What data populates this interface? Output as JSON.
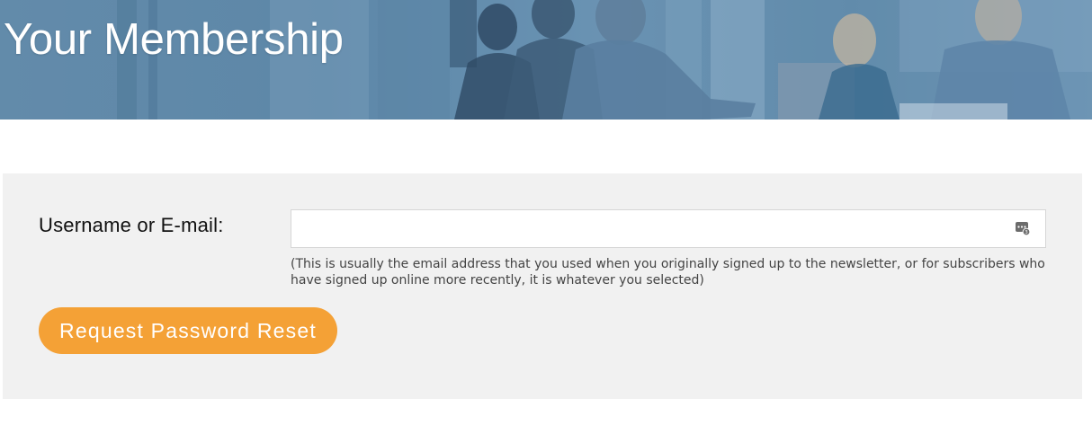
{
  "hero": {
    "title": "Your Membership"
  },
  "form": {
    "username_label": "Username or E-mail:",
    "username_value": "",
    "username_placeholder": "",
    "help_text": "(This is usually the email address that you used when you originally signed up to the newsletter, or for subscribers who have signed up online more recently, it is whatever you selected)",
    "submit_label": "Request Password Reset",
    "password_manager_icon": "password-manager-icon"
  },
  "colors": {
    "hero_overlay": "#5f87a6",
    "panel_bg": "#f1f1f1",
    "button_bg": "#f4a136",
    "button_text": "#ffffff"
  }
}
